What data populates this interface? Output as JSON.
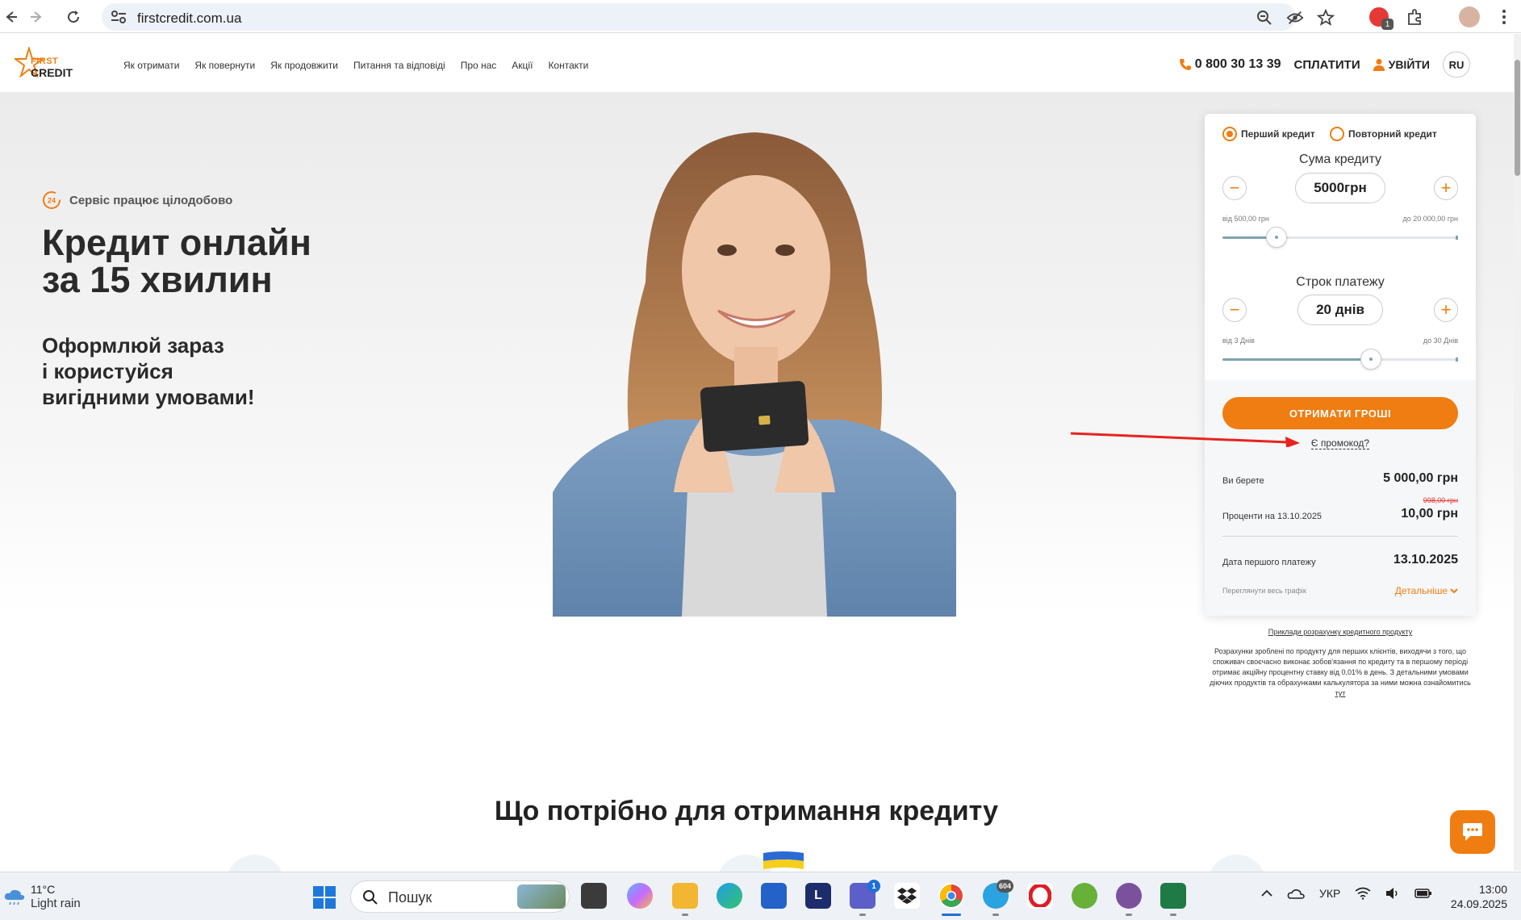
{
  "browser": {
    "url": "firstcredit.com.ua",
    "profile_badge": "1"
  },
  "header": {
    "logo_top": "FIRST",
    "logo_bottom": "CREDIT",
    "nav": [
      "Як отримати",
      "Як повернути",
      "Як продовжити",
      "Питання та відповіді",
      "Про нас",
      "Акції",
      "Контакти"
    ],
    "phone": "0 800 30 13 39",
    "pay": "СПЛАТИТИ",
    "login": "УВІЙТИ",
    "lang": "RU"
  },
  "hero": {
    "badge": "Сервіс працює цілодобово",
    "badge_icon_text": "24",
    "title_line1": "Кредит онлайн",
    "title_line2": "за 15 хвилин",
    "sub_line1": "Оформлюй зараз",
    "sub_line2": "і користуйся",
    "sub_line3": "вигідними умовами!"
  },
  "calculator": {
    "credit_type_first": "Перший кредит",
    "credit_type_repeat": "Повторний кредит",
    "selected_type": "first",
    "amount_label": "Сума кредиту",
    "amount_value": "5000грн",
    "amount_min": "від 500,00 грн",
    "amount_max": "до 20 000,00 грн",
    "amount_fraction": 0.23,
    "term_label": "Строк платежу",
    "term_value": "20 днів",
    "term_min": "від 3 Днів",
    "term_max": "до 30 Днів",
    "term_fraction": 0.63,
    "cta": "ОТРИМАТИ ГРОШІ",
    "promo": "Є промокод?",
    "you_take_label": "Ви берете",
    "you_take_value": "5 000,00 грн",
    "interest_label": "Проценти на 13.10.2025",
    "interest_old": "998,00 грн",
    "interest_value": "10,00 грн",
    "first_payment_label": "Дата першого платежу",
    "first_payment_value": "13.10.2025",
    "schedule_label": "Переглянути весь графік",
    "details_link": "Детальніше"
  },
  "disclaimer": {
    "examples_link": "Приклади розрахунку кредитного продукту",
    "text": "Розрахунки зроблені по продукту для перших клієнтів, виходячи з того, що споживач своєчасно виконає зобов'язання по кредиту та в першому періоді отримає акційну процентну ставку від 0,01% в день. З детальними умовами діючих продуктів та обрахунками калькулятора за ними можна ознайомитись",
    "here": "тут"
  },
  "section": {
    "title": "Що потрібно для отримання кредиту"
  },
  "taskbar": {
    "temp": "11°C",
    "weather": "Light rain",
    "search": "Пошук",
    "lang": "УКР",
    "time": "13:00",
    "date": "24.09.2025",
    "teams_badge": "1",
    "telegram_badge": "604",
    "app_l": "L"
  },
  "colors": {
    "accent": "#f07d11",
    "slider": "#7fa3b1",
    "annotation": "#e8231d"
  }
}
